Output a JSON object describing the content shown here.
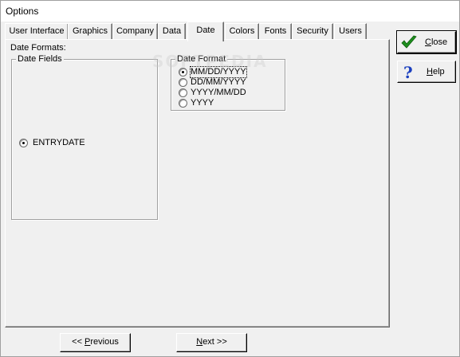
{
  "window": {
    "title": "Options"
  },
  "tabs": [
    {
      "label": "User Interface"
    },
    {
      "label": "Graphics"
    },
    {
      "label": "Company"
    },
    {
      "label": "Data"
    },
    {
      "label": "Date"
    },
    {
      "label": "Colors"
    },
    {
      "label": "Fonts"
    },
    {
      "label": "Security"
    },
    {
      "label": "Users"
    }
  ],
  "active_tab": "Date",
  "date_formats": {
    "heading": "Date Formats:",
    "fields_group": {
      "title": "Date Fields",
      "items": [
        {
          "label": "ENTRYDATE",
          "checked": true
        }
      ]
    },
    "format_group": {
      "title": "Date Format",
      "options": [
        {
          "label": "MM/DD/YYYY",
          "checked": true
        },
        {
          "label": "DD/MM/YYYY",
          "checked": false
        },
        {
          "label": "YYYY/MM/DD",
          "checked": false
        },
        {
          "label": "YYYY",
          "checked": false
        }
      ]
    }
  },
  "side_buttons": {
    "close": {
      "label": "Close",
      "mnemonic": "C",
      "rest": "lose",
      "icon": "checkmark-icon",
      "icon_color": "#1e8f1e"
    },
    "help": {
      "label": "Help",
      "mnemonic": "H",
      "rest": "elp",
      "icon": "question-mark-icon",
      "icon_color": "#1a3fbf"
    }
  },
  "nav_buttons": {
    "previous": {
      "prefix": "<< ",
      "mnemonic": "P",
      "rest": "revious"
    },
    "next": {
      "mnemonic": "N",
      "rest": "ext >>"
    }
  },
  "watermark": "SOFTPEDIA"
}
